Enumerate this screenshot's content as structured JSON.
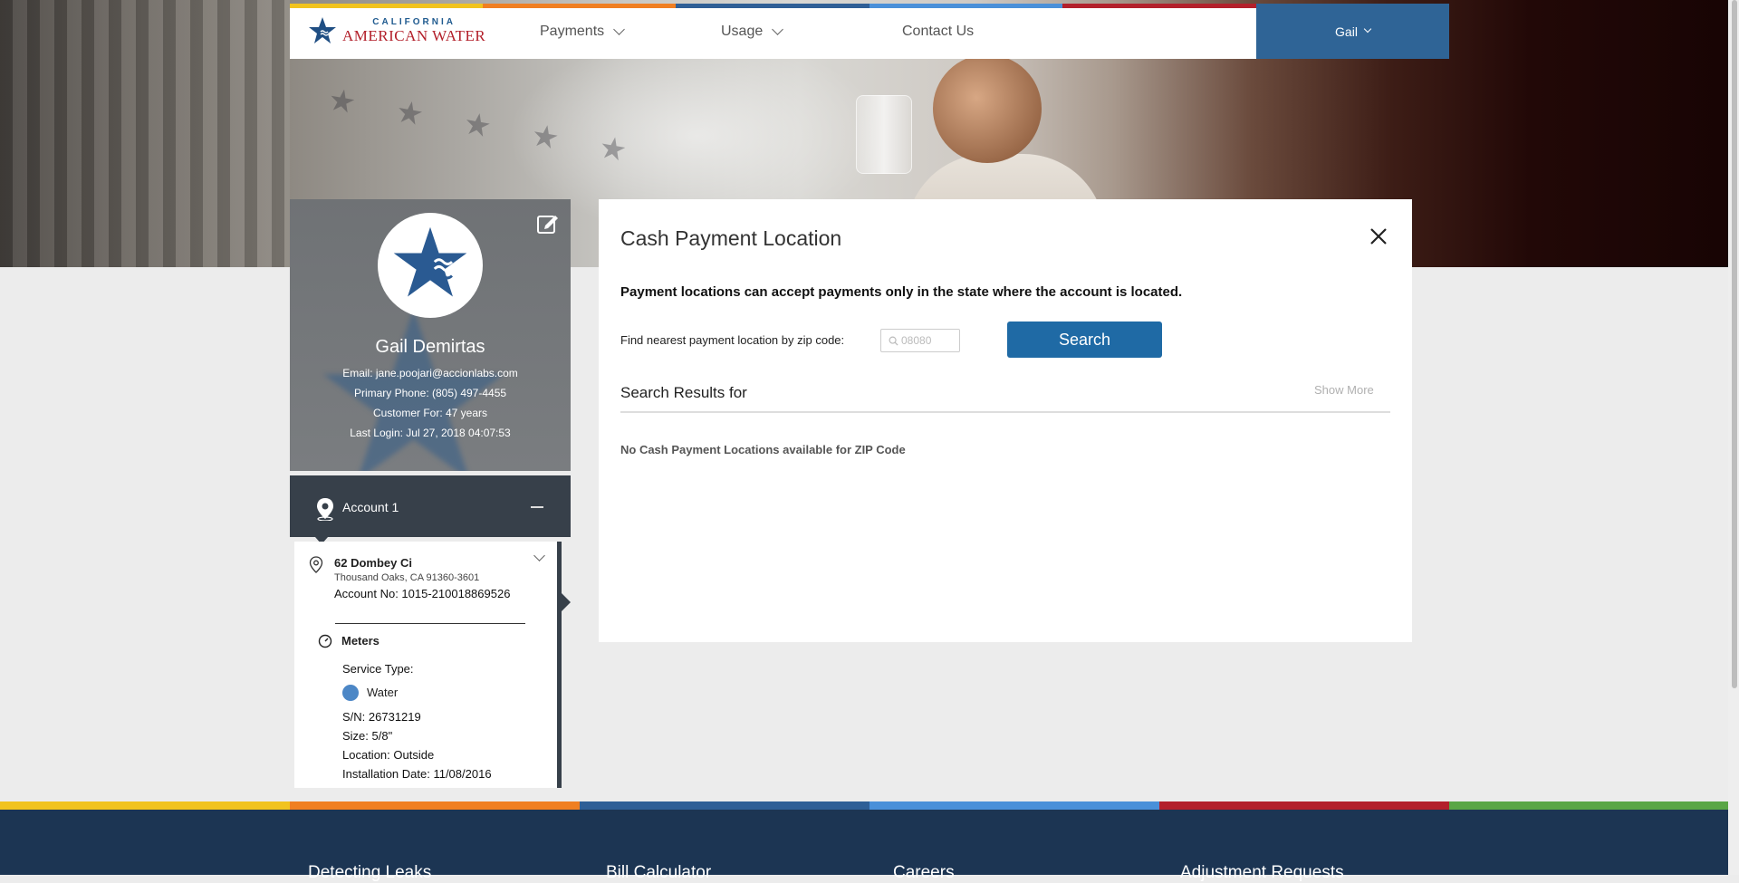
{
  "nav": {
    "logo_line1": "CALIFORNIA",
    "logo_line2": "AMERICAN WATER",
    "items": [
      {
        "label": "Payments"
      },
      {
        "label": "Usage"
      },
      {
        "label": "Contact Us"
      }
    ],
    "user_label": "Gail",
    "stripe_colors": [
      "#f1c31e",
      "#f07f22",
      "#2f5f96",
      "#4a90d9",
      "#b3202b",
      "#5aa646"
    ]
  },
  "profile": {
    "name": "Gail Demirtas",
    "email": "Email: jane.poojari@accionlabs.com",
    "phone": "Primary Phone: (805) 497-4455",
    "customer_for": "Customer For: 47 years",
    "last_login": "Last Login: Jul 27, 2018 04:07:53"
  },
  "account": {
    "title": "Account 1",
    "street": "62 Dombey Ci",
    "city": "Thousand Oaks, CA 91360-3601",
    "account_no": "Account No: 1015-210018869526",
    "meters": {
      "title": "Meters",
      "service_type_label": "Service Type:",
      "service_type": "Water",
      "serial": "S/N: 26731219",
      "size": "Size: 5/8\"",
      "location": "Location: Outside",
      "install_date": "Installation Date: 11/08/2016"
    }
  },
  "modal": {
    "title": "Cash Payment Location",
    "notice": "Payment locations can accept payments only in the state where the account is located.",
    "find_label": "Find nearest payment location by zip code:",
    "zip_placeholder": "08080",
    "search_label": "Search",
    "results_heading": "Search Results for",
    "show_more": "Show More",
    "no_results": "No Cash Payment Locations available for ZIP Code"
  },
  "footer": {
    "links": [
      {
        "label": "Detecting Leaks"
      },
      {
        "label": "Bill Calculator"
      },
      {
        "label": "Careers"
      },
      {
        "label": "Adjustment Requests"
      }
    ]
  }
}
